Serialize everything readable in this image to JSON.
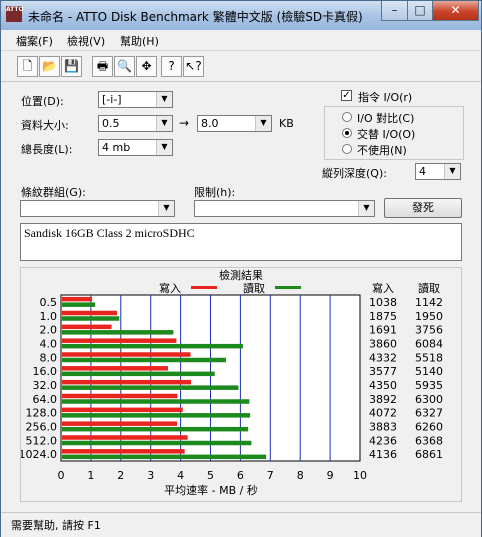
{
  "window": {
    "title": "未命名 - ATTO Disk Benchmark  繁體中文版 (檢驗SD卡真假)",
    "app_icon_text": "ATTO",
    "min_glyph": "–",
    "max_glyph": "□",
    "close_glyph": "✕"
  },
  "menu": [
    "檔案(F)",
    "檢視(V)",
    "幫助(H)"
  ],
  "toolbar": {
    "icons": [
      "new-file-icon",
      "open-folder-icon",
      "save-icon",
      "print-icon",
      "print-preview-icon",
      "move-icon",
      "help-icon",
      "context-help-icon"
    ],
    "glyphs": [
      "🗋",
      "📂",
      "💾",
      "🖶",
      "🔍",
      "✥",
      "?",
      "↖?"
    ]
  },
  "form": {
    "drive_label": "位置(D):",
    "drive_value": "[-i-]",
    "size_label": "資料大小:",
    "size_from": "0.5",
    "size_arrow": "→",
    "size_to": "8.0",
    "size_unit": "KB",
    "length_label": "總長度(L):",
    "length_value": "4 mb",
    "direct_io_label": "指令 I/O(r)",
    "direct_io_checked": "✓",
    "io_compare_label": "I/O 對比(C)",
    "overlapped_io_label": "交替 I/O(O)",
    "neither_label": "不使用(N)",
    "queue_depth_label": "縱列深度(Q):",
    "queue_depth_value": "4",
    "test_pattern_label": "條紋群組(G):",
    "test_pattern_value": "",
    "restrict_label": "限制(h):",
    "restrict_value": "",
    "run_button": "發死",
    "description": "Sandisk 16GB Class 2 microSDHC"
  },
  "colors": {
    "write": "#e8251f",
    "read": "#1d8a1d",
    "grid": "#1b2fb8"
  },
  "chart_data": {
    "type": "bar",
    "orientation": "horizontal",
    "title": "檢測結果",
    "xlabel": "平均速率 - MB / 秒",
    "xlim": [
      0,
      10
    ],
    "xticks": [
      "0",
      "1",
      "2",
      "3",
      "4",
      "5",
      "6",
      "7",
      "8",
      "9",
      "10"
    ],
    "categories": [
      "0.5",
      "1.0",
      "2.0",
      "4.0",
      "8.0",
      "16.0",
      "32.0",
      "64.0",
      "128.0",
      "256.0",
      "512.0",
      "1024.0"
    ],
    "series": [
      {
        "name": "寫入",
        "color": "#e8251f",
        "values": [
          1.038,
          1.875,
          1.691,
          3.86,
          4.332,
          3.577,
          4.35,
          3.892,
          4.072,
          3.883,
          4.236,
          4.136
        ]
      },
      {
        "name": "讀取",
        "color": "#1d8a1d",
        "values": [
          1.142,
          1.95,
          3.756,
          6.084,
          5.518,
          5.14,
          5.935,
          6.3,
          6.327,
          6.26,
          6.368,
          6.861
        ]
      }
    ],
    "table": {
      "write_header": "寫入",
      "read_header": "讀取",
      "write": [
        "1038",
        "1875",
        "1691",
        "3860",
        "4332",
        "3577",
        "4350",
        "3892",
        "4072",
        "3883",
        "4236",
        "4136"
      ],
      "read": [
        "1142",
        "1950",
        "3756",
        "6084",
        "5518",
        "5140",
        "5935",
        "6300",
        "6327",
        "6260",
        "6368",
        "6861"
      ]
    }
  },
  "status": "需要幫助, 請按 F1"
}
